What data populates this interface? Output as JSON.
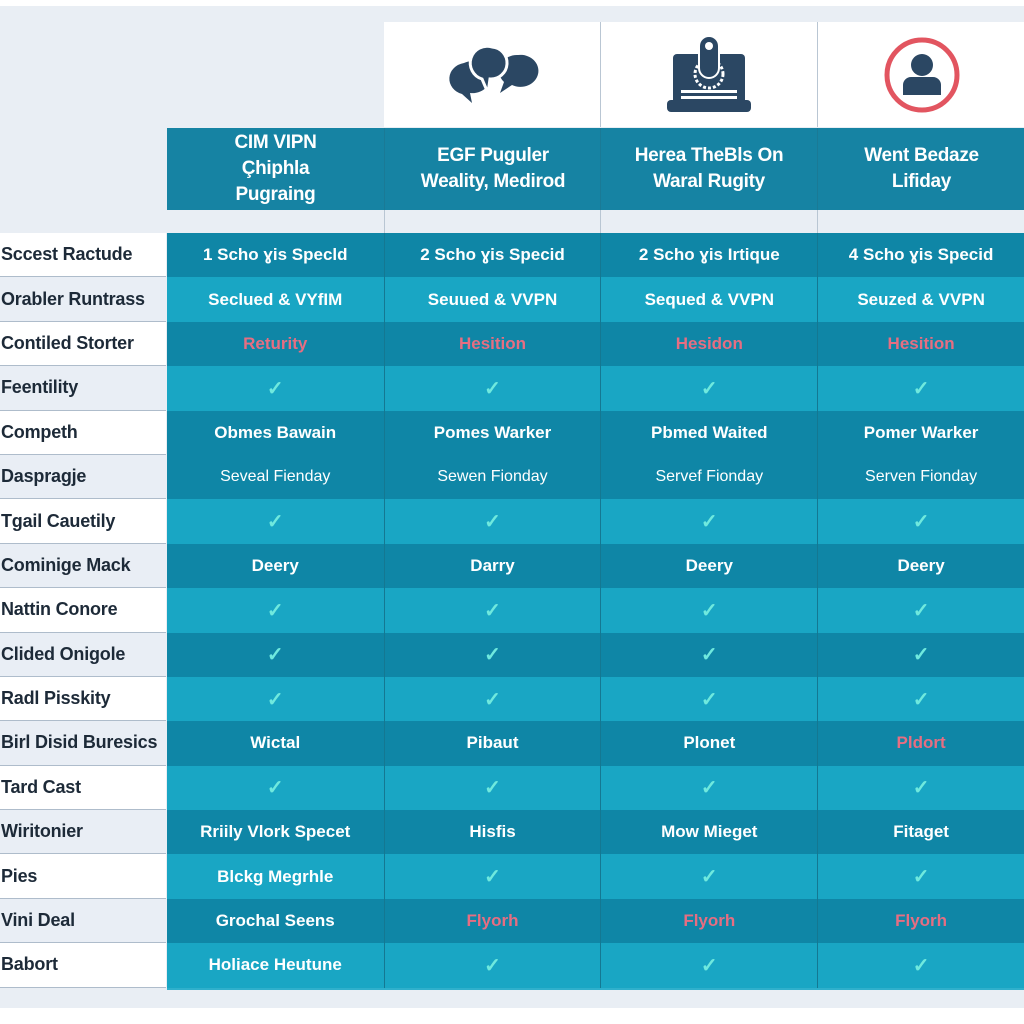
{
  "colors": {
    "header_bg": "#1683a3",
    "row_dark": "#0f86a6",
    "row_light": "#19a6c4",
    "check": "#6fe9de",
    "warning_text": "#e66e82",
    "icon_navy": "#2b4763",
    "icon_red": "#e25560"
  },
  "columns": [
    {
      "icon": "chat-bubbles-icon",
      "title_lines": [
        "CIM VIPN",
        "Çhiphla",
        "Pugraing"
      ]
    },
    {
      "icon": "chat-bubbles-icon",
      "title_lines": [
        "EGF Puguler",
        "Weality, Medirod"
      ]
    },
    {
      "icon": "laptop-lock-icon",
      "title_lines": [
        "Herea TheBls On",
        "Waral Rugity"
      ]
    },
    {
      "icon": "user-circle-icon",
      "title_lines": [
        "Went Bedaze",
        "Lifiday"
      ]
    }
  ],
  "rows": [
    {
      "label": "Sccest Ractude",
      "tone": "dark",
      "cells": [
        {
          "t": "1 Scho ɣis Specld"
        },
        {
          "t": "2 Scho ɣis Specid"
        },
        {
          "t": "2 Scho ɣis Irtique"
        },
        {
          "t": "4 Scho ɣis Specid"
        }
      ]
    },
    {
      "label": "Orabler Runtrass",
      "tone": "light",
      "cells": [
        {
          "t": "Seclued & VYfIM"
        },
        {
          "t": "Seuued & VVPN"
        },
        {
          "t": "Sequed & VVPN"
        },
        {
          "t": "Seuzed & VVPN"
        }
      ]
    },
    {
      "label": "Contiled Storter",
      "tone": "dark",
      "cells": [
        {
          "t": "Returity",
          "red": true
        },
        {
          "t": "Hesition",
          "red": true
        },
        {
          "t": "Hesidon",
          "red": true
        },
        {
          "t": "Hesition",
          "red": true
        }
      ]
    },
    {
      "label": "Feentility",
      "tone": "light",
      "cells": [
        {
          "check": true
        },
        {
          "check": true
        },
        {
          "check": true
        },
        {
          "check": true
        }
      ]
    },
    {
      "label": "Competh",
      "tone": "dark",
      "cells": [
        {
          "t": "Obmes Bawain"
        },
        {
          "t": "Pomes Warker"
        },
        {
          "t": "Pbmed Waited"
        },
        {
          "t": "Pomer Warker"
        }
      ]
    },
    {
      "label": "Daspragje",
      "tone": "dark",
      "cells": [
        {
          "t": "Seveal Fienday",
          "small": true
        },
        {
          "t": "Sewen Fionday",
          "small": true
        },
        {
          "t": "Servef Fionday",
          "small": true
        },
        {
          "t": "Serven Fionday",
          "small": true
        }
      ]
    },
    {
      "label": "Tgail Cauetily",
      "tone": "light",
      "cells": [
        {
          "check": true
        },
        {
          "check": true
        },
        {
          "check": true
        },
        {
          "check": true
        }
      ]
    },
    {
      "label": "Cominige Mack",
      "tone": "dark",
      "cells": [
        {
          "t": "Deery"
        },
        {
          "t": "Darry"
        },
        {
          "t": "Deery"
        },
        {
          "t": "Deery"
        }
      ]
    },
    {
      "label": "Nattin Conore",
      "tone": "light",
      "cells": [
        {
          "check": true
        },
        {
          "check": true
        },
        {
          "check": true
        },
        {
          "check": true
        }
      ]
    },
    {
      "label": "Clided Onigole",
      "tone": "dark",
      "cells": [
        {
          "check": true
        },
        {
          "check": true
        },
        {
          "check": true
        },
        {
          "check": true
        }
      ]
    },
    {
      "label": "Radl Pisskity",
      "tone": "light",
      "cells": [
        {
          "check": true
        },
        {
          "check": true
        },
        {
          "check": true
        },
        {
          "check": true
        }
      ]
    },
    {
      "label": "Birl Disid Buresics",
      "tone": "dark",
      "cells": [
        {
          "t": "Wictal"
        },
        {
          "t": "Pibaut"
        },
        {
          "t": "Plonet"
        },
        {
          "t": "Pldort",
          "red": true
        }
      ]
    },
    {
      "label": "Tard Cast",
      "tone": "light",
      "cells": [
        {
          "check": true
        },
        {
          "check": true
        },
        {
          "check": true
        },
        {
          "check": true
        }
      ]
    },
    {
      "label": "Wiritonier",
      "tone": "dark",
      "cells": [
        {
          "t": "Rriily Vlork Specet"
        },
        {
          "t": "Hisfis"
        },
        {
          "t": "Mow Mieget"
        },
        {
          "t": "Fitaget"
        }
      ]
    },
    {
      "label": "Pies",
      "tone": "light",
      "cells": [
        {
          "t": "Blckg Megrhle"
        },
        {
          "check": true
        },
        {
          "check": true
        },
        {
          "check": true
        }
      ]
    },
    {
      "label": "Vini Deal",
      "tone": "dark",
      "cells": [
        {
          "t": "Grochal Seens"
        },
        {
          "t": "Flyorh",
          "red": true
        },
        {
          "t": "Flyorh",
          "red": true
        },
        {
          "t": "Flyorh",
          "red": true
        }
      ]
    },
    {
      "label": "Babort",
      "tone": "light",
      "cells": [
        {
          "t": "Holiace Heutune"
        },
        {
          "check": true
        },
        {
          "check": true
        },
        {
          "check": true
        }
      ]
    }
  ],
  "check_glyph": "✓"
}
